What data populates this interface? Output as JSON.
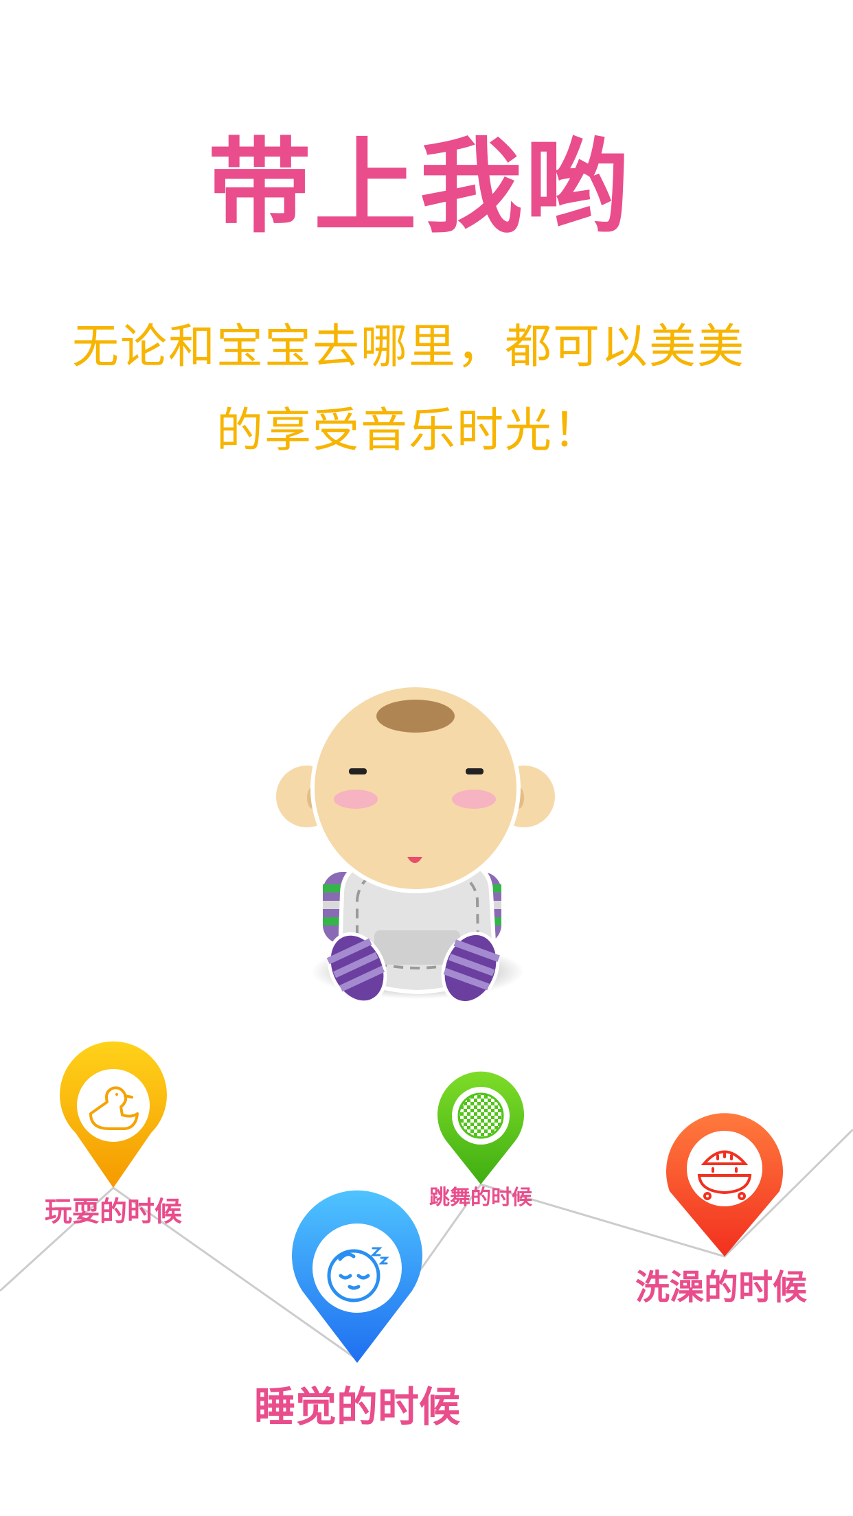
{
  "header": {
    "title": "带上我哟",
    "subtitle_line1": "无论和宝宝去哪里，都可以美美",
    "subtitle_line2": "的享受音乐时光！"
  },
  "illustration": {
    "name": "baby-character"
  },
  "moments": [
    {
      "label": "玩耍的时候",
      "icon": "duck-icon",
      "color": "#f7b400"
    },
    {
      "label": "睡觉的时候",
      "icon": "sleeping-baby-icon",
      "color": "#2a8ff0"
    },
    {
      "label": "跳舞的时候",
      "icon": "disco-ball-icon",
      "color": "#52c41a"
    },
    {
      "label": "洗澡的时候",
      "icon": "bathtub-shower-icon",
      "color": "#ff4d2e"
    }
  ],
  "colors": {
    "title": "#e94d8c",
    "subtitle": "#f7b400",
    "line": "#cccccc"
  }
}
